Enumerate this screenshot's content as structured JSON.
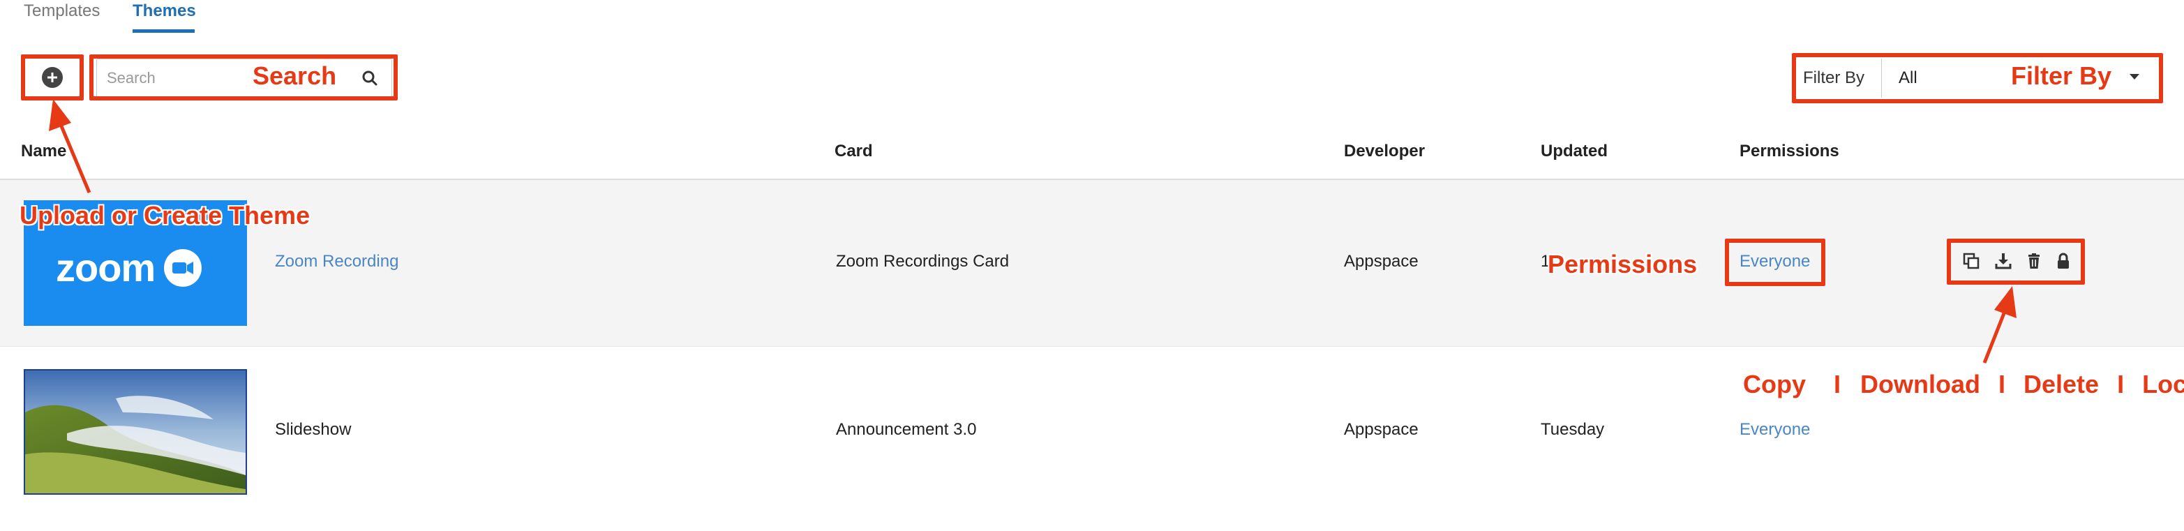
{
  "tabs": [
    {
      "label": "Templates",
      "active": false
    },
    {
      "label": "Themes",
      "active": true
    }
  ],
  "toolbar": {
    "search_placeholder": "Search",
    "filter_label": "Filter By",
    "filter_value": "All"
  },
  "table": {
    "columns": [
      "Name",
      "Card",
      "Developer",
      "Updated",
      "Permissions"
    ],
    "rows": [
      {
        "name": "Zoom Recording",
        "card": "Zoom Recordings Card",
        "developer": "Appspace",
        "updated": "1",
        "permissions": "Everyone",
        "thumbnail": "zoom-logo",
        "highlighted": true
      },
      {
        "name": "Slideshow",
        "card": "Announcement 3.0",
        "developer": "Appspace",
        "updated": "Tuesday",
        "permissions": "Everyone",
        "thumbnail": "misty-hills-photo",
        "highlighted": false
      }
    ]
  },
  "thumbnail_text": {
    "zoom": "zoom"
  },
  "row_actions": [
    "copy-icon",
    "download-icon",
    "delete-icon",
    "lock-icon"
  ],
  "annotations": {
    "search": "Search",
    "filter_by": "Filter By",
    "upload_create": "Upload or Create Theme",
    "permissions": "Permissions",
    "copy": "Copy",
    "sep1": "I",
    "download": "Download",
    "sep2": "I",
    "delete": "Delete",
    "sep3": "I",
    "lock": "Lock"
  },
  "colors": {
    "accent": "#1f6fb2",
    "link": "#4a86c5",
    "annotation": "#e63a17",
    "zoom_blue": "#1a8cf0",
    "highlight_row": "#f4f4f4"
  }
}
